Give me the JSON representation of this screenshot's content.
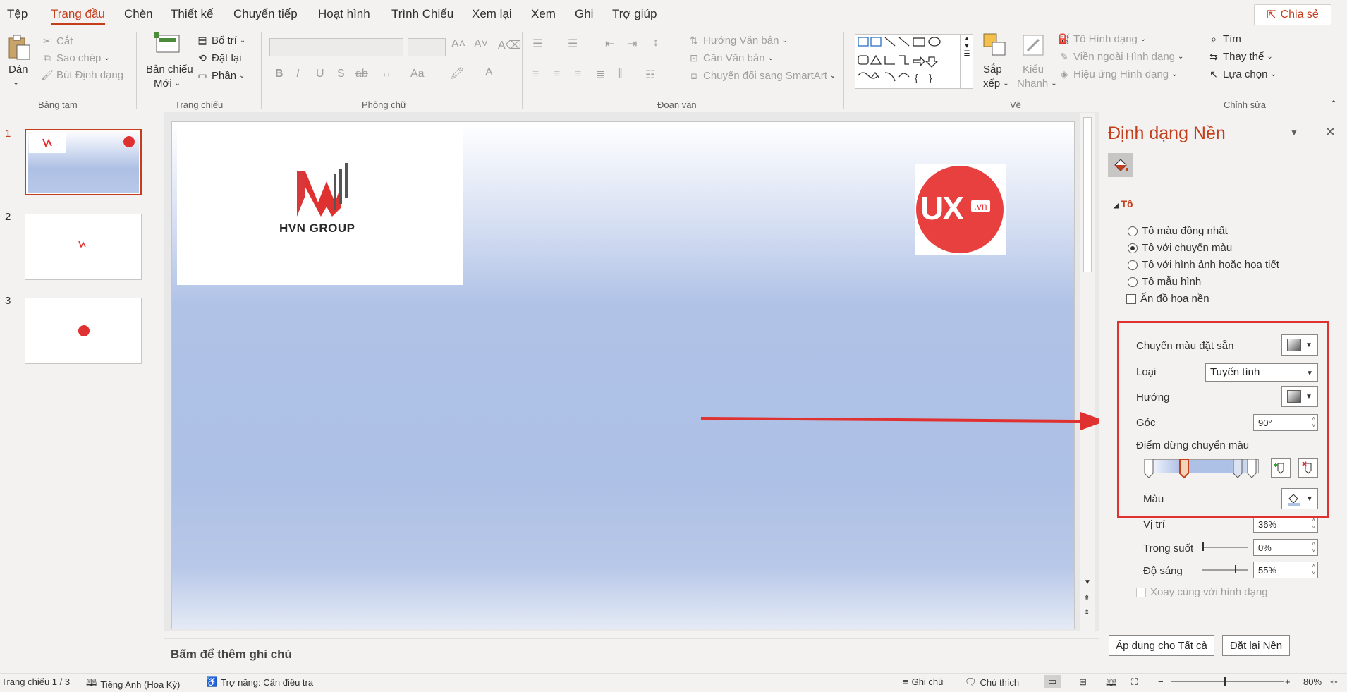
{
  "menu": {
    "tabs": [
      "Tệp",
      "Trang đầu",
      "Chèn",
      "Thiết kế",
      "Chuyển tiếp",
      "Hoạt hình",
      "Trình Chiếu",
      "Xem lại",
      "Xem",
      "Ghi",
      "Trợ giúp"
    ],
    "active_tab": "Trang đầu",
    "share": "Chia sẻ"
  },
  "ribbon": {
    "clipboard": {
      "paste": "Dán",
      "cut": "Cắt",
      "copy": "Sao chép",
      "format_painter": "Bút Định dạng",
      "label": "Bảng tạm"
    },
    "slides": {
      "new_slide_1": "Bản chiếu",
      "new_slide_2": "Mới",
      "layout": "Bố trí",
      "reset": "Đặt lại",
      "section": "Phần",
      "label": "Trang chiếu"
    },
    "font": {
      "label": "Phông chữ",
      "bold": "B",
      "italic": "I",
      "underline": "U",
      "shadow": "S",
      "strike": "ab",
      "case": "Aa"
    },
    "paragraph": {
      "text_direction": "Hướng Văn bản",
      "align_text": "Căn Văn bản",
      "smartart": "Chuyển đổi sang SmartArt",
      "label": "Đoạn văn"
    },
    "drawing": {
      "arrange_1": "Sắp",
      "arrange_2": "xếp",
      "quick_styles_1": "Kiểu",
      "quick_styles_2": "Nhanh",
      "shape_fill": "Tô Hình dạng",
      "shape_outline": "Viền ngoài Hình dạng",
      "shape_effects": "Hiệu ứng Hình dạng",
      "label": "Vẽ"
    },
    "editing": {
      "find": "Tìm",
      "replace": "Thay thế",
      "select": "Lựa chọn",
      "label": "Chỉnh sửa"
    }
  },
  "thumbnails": {
    "numbers": [
      "1",
      "2",
      "3"
    ],
    "selected": "1"
  },
  "slide": {
    "logo_text": "HVN GROUP",
    "ux_text": "UX",
    "ux_domain": ".vn"
  },
  "notes": {
    "placeholder": "Bấm để thêm ghi chú"
  },
  "pane": {
    "title": "Định dạng Nền",
    "section": "Tô",
    "fill_options": [
      "Tô màu đồng nhất",
      "Tô với chuyển màu",
      "Tô với hình ảnh hoặc họa tiết",
      "Tô mẫu hình"
    ],
    "selected_fill": "Tô với chuyển màu",
    "hide_background": "Ẩn đồ họa nền",
    "preset_gradients": "Chuyển màu đặt sẵn",
    "type_label": "Loại",
    "type_value": "Tuyến tính",
    "direction_label": "Hướng",
    "angle_label": "Góc",
    "angle_value": "90°",
    "stops_label": "Điểm dừng chuyển màu",
    "color_label": "Màu",
    "position_label": "Vị trí",
    "position_value": "36%",
    "transparency_label": "Trong suốt",
    "transparency_value": "0%",
    "brightness_label": "Độ sáng",
    "brightness_value": "55%",
    "rotate_label": "Xoay cùng với hình dạng",
    "apply_all": "Áp dụng cho Tất cả",
    "reset_bg": "Đặt lại Nền"
  },
  "status": {
    "slide_count": "Trang chiếu 1 / 3",
    "language": "Tiếng Anh (Hoa Kỳ)",
    "accessibility": "Trợ năng: Cần điều tra",
    "notes": "Ghi chú",
    "comments": "Chú thích",
    "zoom": "80%"
  },
  "colors": {
    "accent": "#c43e1c",
    "annotation": "#e03131"
  }
}
